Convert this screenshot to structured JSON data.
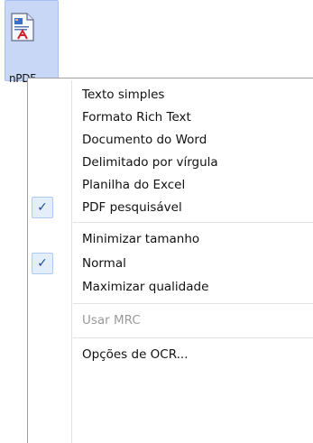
{
  "desktop": {
    "icon_label": "nPDF"
  },
  "menu": {
    "items": [
      {
        "label": "Texto simples",
        "checked": false,
        "disabled": false
      },
      {
        "label": "Formato Rich Text",
        "checked": false,
        "disabled": false
      },
      {
        "label": "Documento do Word",
        "checked": false,
        "disabled": false
      },
      {
        "label": "Delimitado por vírgula",
        "checked": false,
        "disabled": false
      },
      {
        "label": "Planilha do Excel",
        "checked": false,
        "disabled": false
      },
      {
        "label": "PDF pesquisável",
        "checked": true,
        "disabled": false
      },
      {
        "label": "Minimizar tamanho",
        "checked": false,
        "disabled": false
      },
      {
        "label": "Normal",
        "checked": true,
        "disabled": false
      },
      {
        "label": "Maximizar qualidade",
        "checked": false,
        "disabled": false
      },
      {
        "label": "Usar MRC",
        "checked": false,
        "disabled": true
      },
      {
        "label": "Opções de OCR...",
        "checked": false,
        "disabled": false
      }
    ],
    "check_glyph": "✓"
  }
}
